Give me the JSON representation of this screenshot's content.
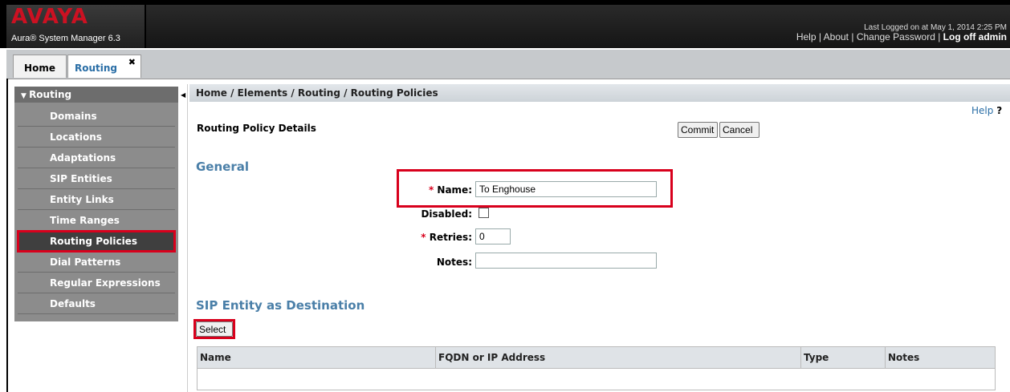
{
  "header": {
    "logo": "AVAYA",
    "product": "Aura® System Manager 6.3",
    "last_logged": "Last Logged on at May 1, 2014 2:25 PM",
    "help": "Help",
    "about": "About",
    "change_password": "Change Password",
    "logoff": "Log off admin",
    "sep": " | "
  },
  "tabs": {
    "home": "Home",
    "routing": "Routing",
    "close": "✖"
  },
  "sidebar": {
    "header": "Routing",
    "items": [
      {
        "label": "Domains"
      },
      {
        "label": "Locations"
      },
      {
        "label": "Adaptations"
      },
      {
        "label": "SIP Entities"
      },
      {
        "label": "Entity Links"
      },
      {
        "label": "Time Ranges"
      },
      {
        "label": "Routing Policies"
      },
      {
        "label": "Dial Patterns"
      },
      {
        "label": "Regular Expressions"
      },
      {
        "label": "Defaults"
      }
    ]
  },
  "main": {
    "breadcrumb": "Home / Elements / Routing / Routing Policies",
    "help": "Help",
    "help_mark": "?",
    "title": "Routing Policy Details",
    "commit": "Commit",
    "cancel": "Cancel",
    "general_title": "General",
    "required_mark": "*",
    "name_label": "Name:",
    "name_value": "To Enghouse",
    "disabled_label": "Disabled:",
    "retries_label": "Retries:",
    "retries_value": "0",
    "notes_label": "Notes:",
    "notes_value": "",
    "sip_title": "SIP Entity as Destination",
    "select": "Select",
    "table_columns": [
      "Name",
      "FQDN or IP Address",
      "Type",
      "Notes"
    ]
  },
  "colors": {
    "accent": "#4a7fa8",
    "highlight": "#d8001c",
    "logo": "#cc1122"
  }
}
